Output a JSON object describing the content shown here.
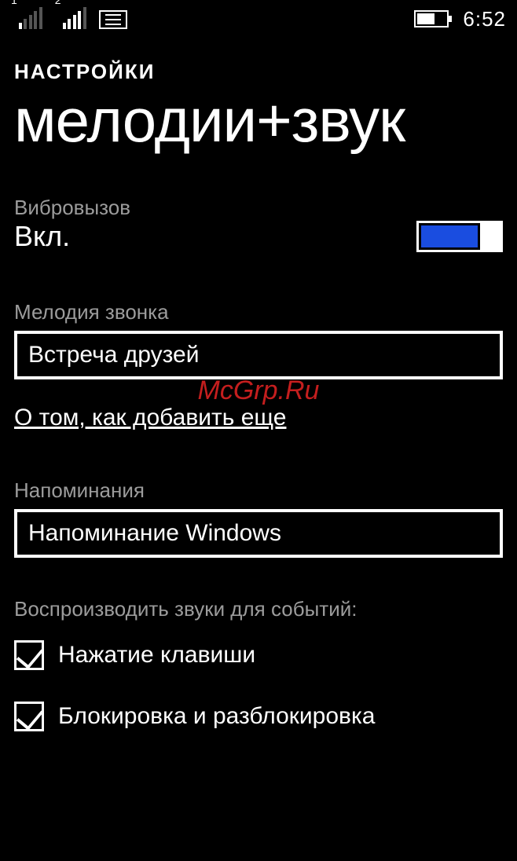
{
  "status": {
    "sim1": "1",
    "sim2": "2",
    "clock": "6:52"
  },
  "header": {
    "section": "НАСТРОЙКИ",
    "title": "мелодии+звук"
  },
  "vibrate": {
    "label": "Вибровызов",
    "value": "Вкл."
  },
  "ringtone": {
    "label": "Мелодия звонка",
    "value": "Встреча друзей"
  },
  "watermark": "McGrp.Ru",
  "add_link": "О том, как добавить еще",
  "reminder": {
    "label": "Напоминания",
    "value": "Напоминание Windows"
  },
  "sounds_for": "Воспроизводить звуки для событий:",
  "checks": {
    "keypress": "Нажатие клавиши",
    "lock": "Блокировка и разблокировка"
  }
}
